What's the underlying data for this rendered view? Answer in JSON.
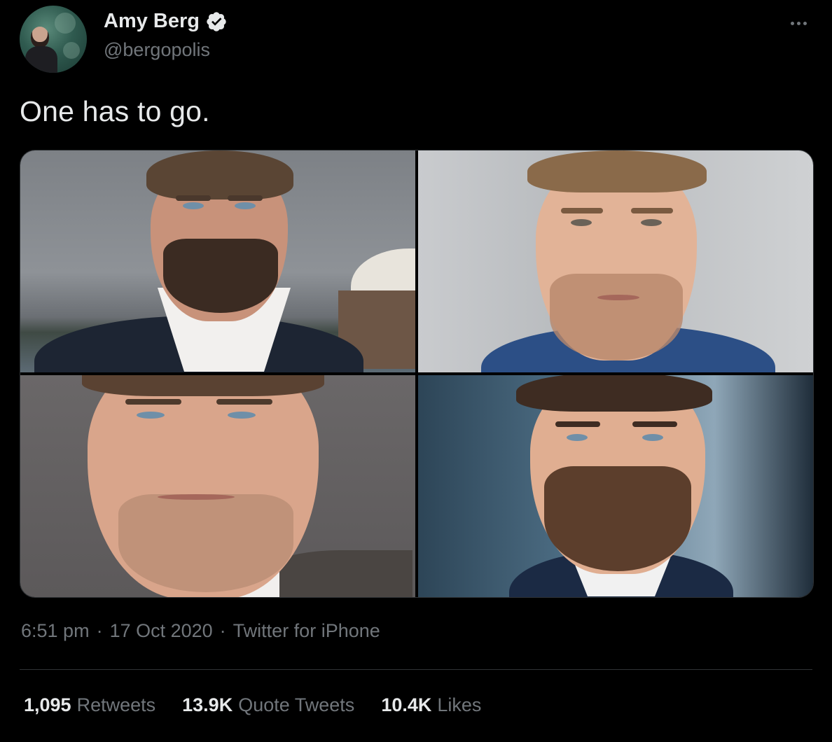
{
  "author": {
    "display_name": "Amy Berg",
    "handle": "@bergopolis",
    "verified": true
  },
  "tweet": {
    "text": "One has to go."
  },
  "media": {
    "photo_count": 4
  },
  "meta": {
    "time": "6:51 pm",
    "separator": "·",
    "date": "17 Oct 2020",
    "source": "Twitter for iPhone"
  },
  "stats": [
    {
      "count": "1,095",
      "label": "Retweets"
    },
    {
      "count": "13.9K",
      "label": "Quote Tweets"
    },
    {
      "count": "10.4K",
      "label": "Likes"
    }
  ],
  "colors": {
    "background": "#000000",
    "primary_text": "#e7e9ea",
    "secondary_text": "#71767b",
    "divider": "#2f3336",
    "verified_badge": "#e7e9ea"
  },
  "icons": {
    "verified": "verified-badge-icon",
    "more": "more-horizontal-icon"
  }
}
